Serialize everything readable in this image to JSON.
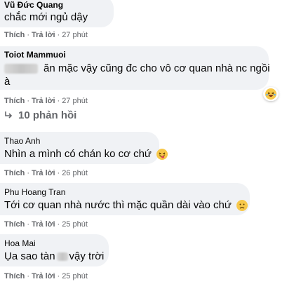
{
  "comments": [
    {
      "author": "Vũ Đức Quang",
      "text": "chắc mới ngủ dậy",
      "like_label": "Thích",
      "reply_label": "Trả lời",
      "time": "27 phút"
    },
    {
      "author": "Toiot Mammuoi",
      "text_line1": "ăn mặc vậy cũng đc cho vô cơ quan nhà nc ngồi",
      "text_line2": "à",
      "like_label": "Thích",
      "reply_label": "Trả lời",
      "time": "27 phút",
      "reaction_icon": "laughing-emoji-icon"
    },
    {
      "author": "Thao Anh",
      "text": "Nhìn a mình có chán ko cơ chứ",
      "emoji_icon": "tongue-wink-emoji-icon",
      "like_label": "Thích",
      "reply_label": "Trả lời",
      "time": "26 phút"
    },
    {
      "author": "Phu Hoang Tran",
      "text": "Tới cơ quan nhà nước thì mặc quần dài vào chứ",
      "emoji_icon": "frowning-emoji-icon",
      "like_label": "Thích",
      "reply_label": "Trả lời",
      "time": "25 phút"
    },
    {
      "author": "Hoa Mai",
      "text_before": "Ụa sao tàn",
      "text_after": "vậy trời",
      "like_label": "Thích",
      "reply_label": "Trả lời",
      "time": "25 phút"
    }
  ],
  "replies": {
    "label": "10 phản hồi",
    "icon": "reply-arrow-icon"
  },
  "colors": {
    "bubble": "#f0f2f5",
    "meta_text": "#65676b",
    "emoji_yellow": "#f7c84a"
  }
}
